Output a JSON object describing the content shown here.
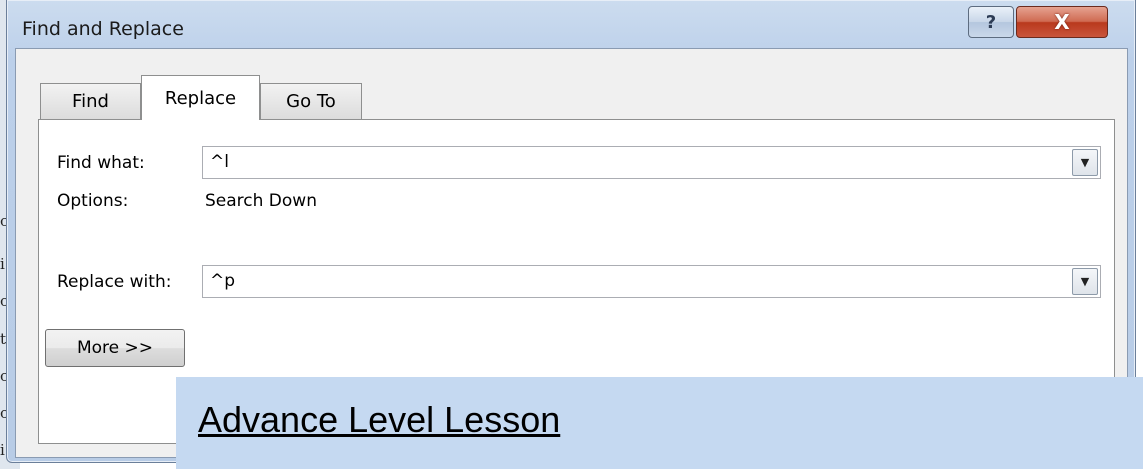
{
  "background": {
    "fragments": [
      "c",
      "i",
      "o",
      "t",
      "c",
      "o",
      "i"
    ]
  },
  "window": {
    "title": "Find and Replace",
    "help_label": "?",
    "close_label": "X"
  },
  "tabs": [
    {
      "label": "Find",
      "active": false
    },
    {
      "label": "Replace",
      "active": true
    },
    {
      "label": "Go To",
      "active": false
    }
  ],
  "replace_tab": {
    "find_what_label": "Find what:",
    "find_what_value": "^l",
    "options_label": "Options:",
    "options_value": "Search Down",
    "replace_with_label": "Replace with:",
    "replace_with_value": "^p",
    "more_button": "More >>"
  },
  "overlay": {
    "text": "Advance Level Lesson"
  },
  "colors": {
    "frame": "#bcd0ea",
    "close": "#c9553c",
    "overlay": "#c5d9f1"
  }
}
